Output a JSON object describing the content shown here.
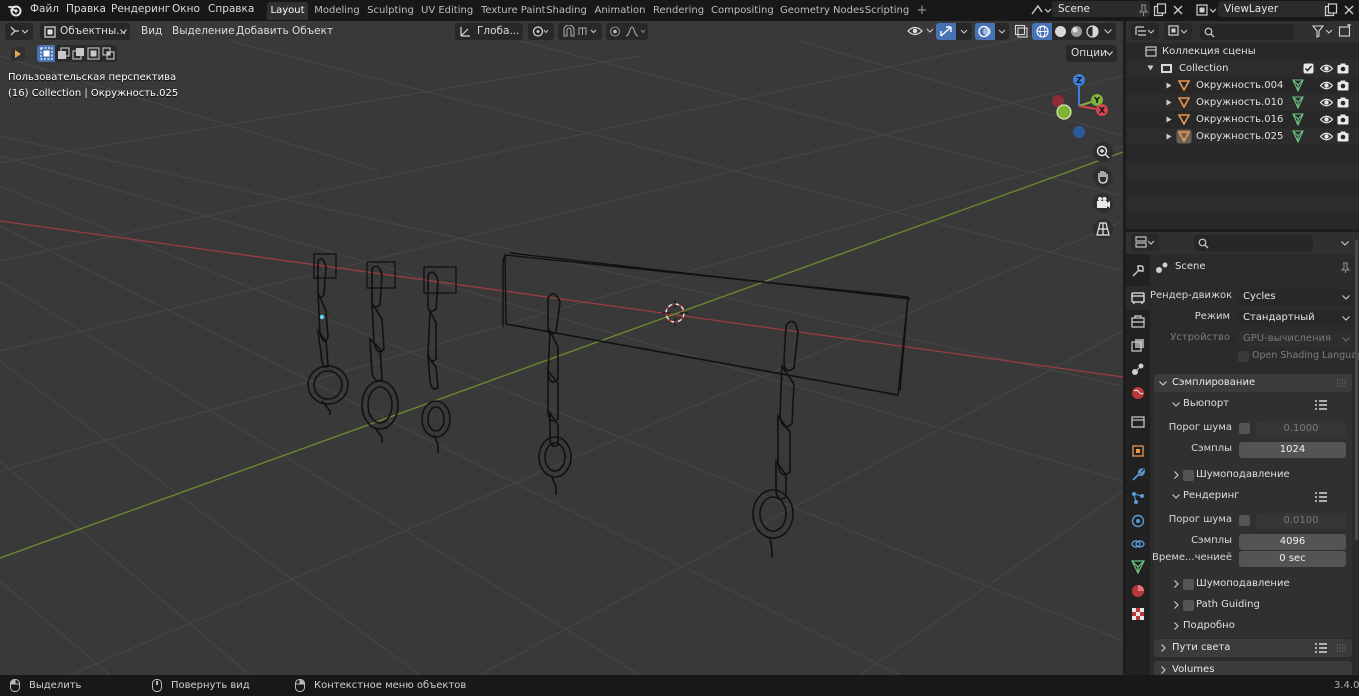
{
  "menu": {
    "items": [
      "Файл",
      "Правка",
      "Рендеринг",
      "Окно",
      "Справка"
    ],
    "workspaces": [
      "Layout",
      "Modeling",
      "Sculpting",
      "UV Editing",
      "Texture Paint",
      "Shading",
      "Animation",
      "Rendering",
      "Compositing",
      "Geometry Nodes",
      "Scripting"
    ],
    "active_workspace": "Layout",
    "add_tab": "+"
  },
  "scene_selector": {
    "value": "Scene"
  },
  "viewlayer_selector": {
    "value": "ViewLayer"
  },
  "viewport": {
    "mode": "Объектны...",
    "menus": [
      "Вид",
      "Выделение",
      "Добавить",
      "Объект"
    ],
    "transform_orientation": "Глоба...",
    "options_label": "Опции",
    "perspective_text": "Пользовательская перспектива",
    "selection_text": "(16) Collection | Окружность.025",
    "gizmo": {
      "x": "X",
      "y": "Y",
      "z": "Z"
    }
  },
  "outliner": {
    "root": "Коллекция сцены",
    "collection": "Collection",
    "objects": [
      "Окружность.004",
      "Окружность.010",
      "Окружность.016",
      "Окружность.025"
    ]
  },
  "properties": {
    "scene_name": "Scene",
    "render_engine_label": "Рендер-движок",
    "render_engine": "Cycles",
    "mode_label": "Режим",
    "mode": "Стандартный",
    "device_label": "Устройство",
    "device": "GPU-вычисления",
    "osl_label": "Open Shading Language",
    "sampling_panel": "Сэмплирование",
    "viewport_sub": "Вьюпорт",
    "noise_threshold_label": "Порог шума",
    "viewport_noise_threshold": "0.1000",
    "samples_label": "Сэмплы",
    "viewport_samples": "1024",
    "denoise_label": "Шумоподавление",
    "render_sub": "Рендеринг",
    "render_noise_threshold": "0.0100",
    "render_samples": "4096",
    "time_limit_label": "Време...чениеё",
    "time_limit": "0 sec",
    "path_guiding_label": "Path Guiding",
    "advanced_label": "Подробно",
    "light_paths_panel": "Пути света",
    "volumes_panel": "Volumes"
  },
  "status_bar": {
    "select": "Выделить",
    "rotate": "Повернуть вид",
    "context_menu": "Контекстное меню объектов",
    "version": "3.4.0"
  },
  "colors": {
    "accent": "#4772b3",
    "x_axis": "#d0444c",
    "y_axis": "#7eb338",
    "z_axis": "#3d7fd8",
    "mesh_icon": "#e8964e",
    "data_icon": "#69c482"
  }
}
